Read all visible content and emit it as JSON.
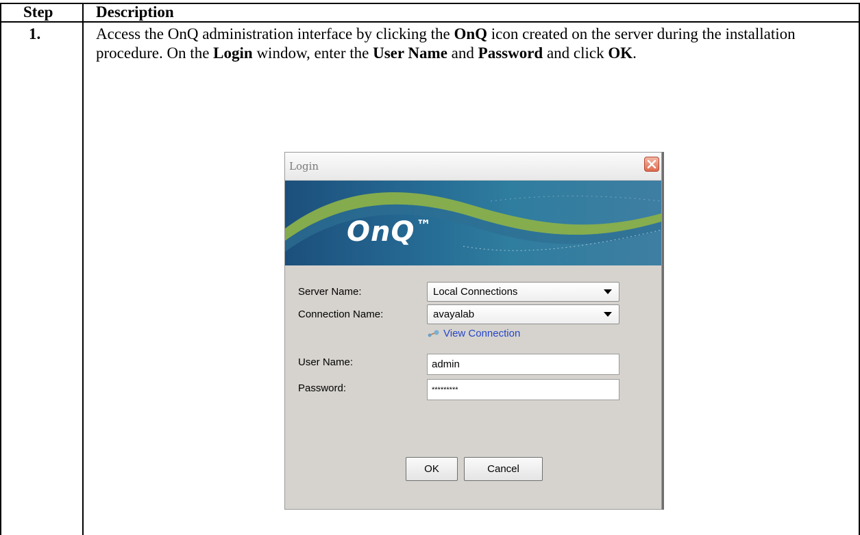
{
  "table": {
    "header_step": "Step",
    "header_description": "Description",
    "row_step": "1.",
    "description": {
      "seg1": "Access the OnQ administration interface by clicking the ",
      "b1": "OnQ",
      "seg2": " icon created on the server during the installation procedure.  On the ",
      "b2": "Login",
      "seg3": " window, enter the ",
      "b3": "User Name",
      "seg4": " and ",
      "b4": "Password",
      "seg5": " and click ",
      "b5": "OK",
      "seg6": "."
    }
  },
  "dialog": {
    "title": "Login",
    "close_icon": "close-icon",
    "logo": "OnQ",
    "logo_tm": "™",
    "server_name_label": "Server Name:",
    "server_name_value": "Local Connections",
    "connection_name_label": "Connection Name:",
    "connection_name_value": "avayalab",
    "view_connection_link": "View Connection",
    "view_connection_icon": "connection-icon",
    "user_name_label": "User Name:",
    "user_name_value": "admin",
    "password_label": "Password:",
    "password_value": "*********",
    "ok_label": "OK",
    "cancel_label": "Cancel"
  },
  "colors": {
    "banner_dark": "#1c4f7c",
    "banner_wave": "#8ab04a",
    "dialog_bg": "#d6d3ce",
    "link": "#2446c8",
    "close_red": "#e06a4e"
  }
}
